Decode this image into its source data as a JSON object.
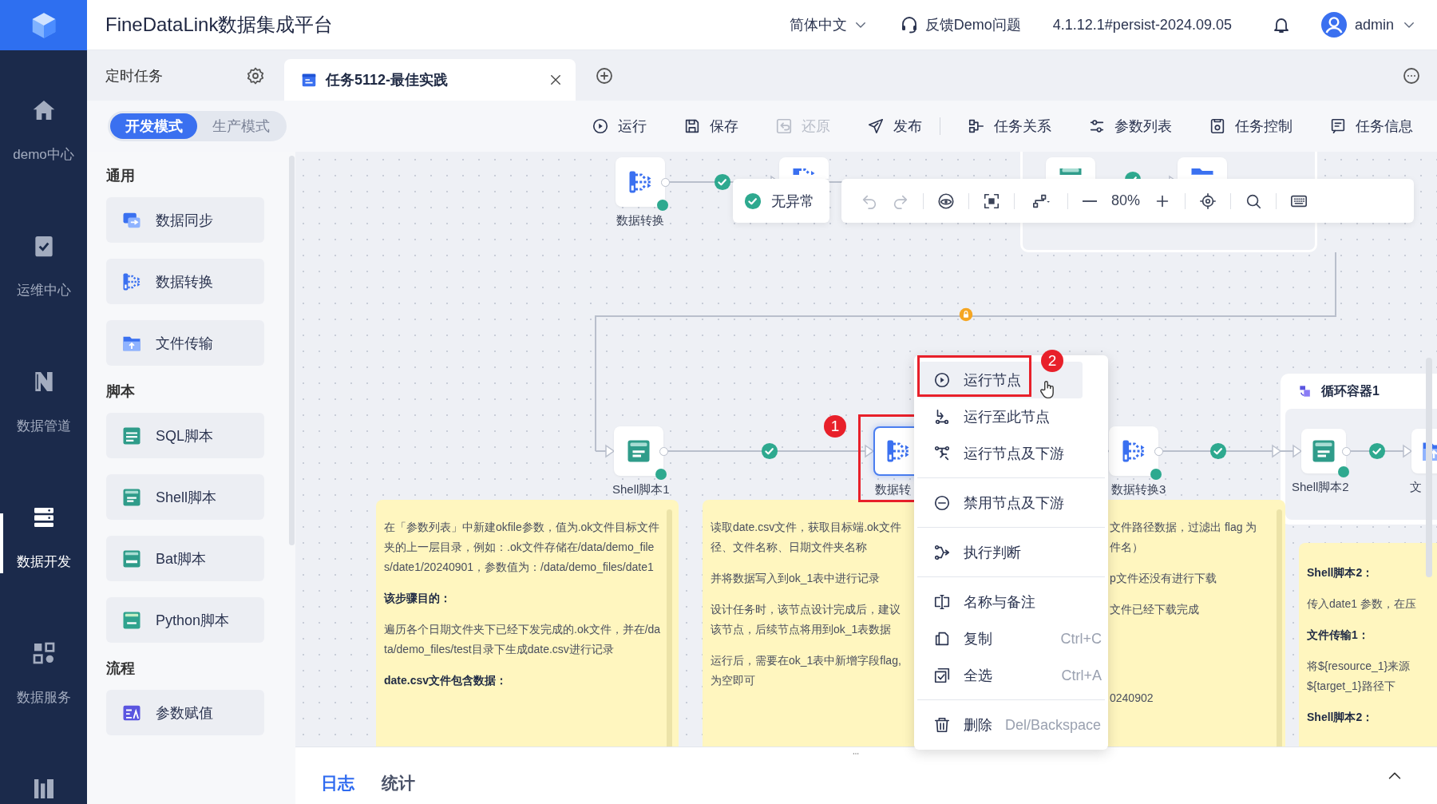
{
  "app": {
    "title": "FineDataLink数据集成平台",
    "language": "简体中文",
    "feedback": "反馈Demo问题",
    "version": "4.1.12.1#persist-2024.09.05",
    "user": "admin"
  },
  "nav": [
    {
      "label": "demo中心",
      "selected": false
    },
    {
      "label": "运维中心",
      "selected": false
    },
    {
      "label": "数据管道",
      "selected": false
    },
    {
      "label": "数据开发",
      "selected": true
    },
    {
      "label": "数据服务",
      "selected": false
    },
    {
      "selected": false
    }
  ],
  "tabs": {
    "section": "定时任务",
    "items": [
      {
        "label": "任务5112-最佳实践",
        "selected": true
      }
    ]
  },
  "modes": [
    {
      "label": "开发模式",
      "selected": true
    },
    {
      "label": "生产模式",
      "selected": false
    }
  ],
  "toolbar": [
    {
      "label": "运行",
      "disabled": false
    },
    {
      "label": "保存",
      "disabled": false
    },
    {
      "label": "还原",
      "disabled": true
    },
    {
      "label": "发布",
      "disabled": false
    },
    {
      "label": "任务关系",
      "disabled": false
    },
    {
      "label": "参数列表",
      "disabled": false
    },
    {
      "label": "任务控制",
      "disabled": false
    },
    {
      "label": "任务信息",
      "disabled": false
    }
  ],
  "palette": [
    {
      "title": "通用",
      "items": [
        {
          "label": "数据同步"
        },
        {
          "label": "数据转换"
        },
        {
          "label": "文件传输"
        }
      ]
    },
    {
      "title": "脚本",
      "items": [
        {
          "label": "SQL脚本"
        },
        {
          "label": "Shell脚本"
        },
        {
          "label": "Bat脚本"
        },
        {
          "label": "Python脚本"
        }
      ]
    },
    {
      "title": "流程",
      "items": [
        {
          "label": "参数赋值"
        }
      ]
    }
  ],
  "canvas": {
    "status": "无异常",
    "zoom": "80%",
    "nodes": [
      {
        "kind": "transform",
        "label": "数据转换",
        "selected": false,
        "succeeded": true
      },
      {
        "kind": "transform",
        "selected": false
      },
      {
        "kind": "shell",
        "selected": false
      },
      {
        "kind": "file",
        "selected": false
      },
      {
        "kind": "shell",
        "label": "Shell脚本1",
        "selected": false,
        "succeeded": true
      },
      {
        "kind": "transform",
        "label": "数据转",
        "selected": true
      },
      {
        "kind": "transform",
        "label": "数据转换3",
        "selected": false,
        "succeeded": true
      },
      {
        "kind": "shell",
        "label": "Shell脚本2",
        "selected": false,
        "succeeded": true
      },
      {
        "kind": "file",
        "label": "文",
        "selected": false
      }
    ],
    "edges": [
      {
        "passed": true
      },
      {
        "passed": true
      },
      {
        "passed": true
      },
      {
        "passed": true
      },
      {
        "passed": true
      }
    ],
    "container": {
      "title": "循环容器1"
    },
    "notes": [
      {
        "paragraphs": [
          {
            "text": "在「参数列表」中新建okfile参数，值为.ok文件目标文件夹的上一层目录，例如：.ok文件存储在/data/demo_files/date1/20240901，参数值为：/data/demo_files/date1",
            "bold": false
          },
          {
            "text": "该步骤目的：",
            "bold": true
          },
          {
            "text": "遍历各个日期文件夹下已经下发完成的.ok文件，并在/data/demo_files/test目录下生成date.csv进行记录",
            "bold": false
          },
          {
            "text": "date.csv文件包含数据：",
            "bold": true
          }
        ]
      },
      {
        "paragraphs": [
          {
            "lines": [
              "读取date.csv文件，获取目标端.ok文件",
              "径、文件名称、日期文件夹名称"
            ],
            "bold": false
          },
          {
            "lines": [
              "并将数据写入到ok_1表中进行记录"
            ],
            "bold": false
          },
          {
            "lines": [
              "设计任务时，该节点设计完成后，建议",
              "该节点，后续节点将用到ok_1表数据"
            ],
            "bold": false
          },
          {
            "lines": [
              "运行后，需要在ok_1表中新增字段flag,",
              "为空即可"
            ],
            "bold": false
          }
        ]
      },
      {
        "paragraphs": [
          {
            "lines": [
              "文件路径数据，过滤出 flag 为",
              "件名）"
            ],
            "bold": false
          },
          {
            "lines": [
              "p文件还没有进行下载"
            ],
            "bold": false
          },
          {
            "lines": [
              "文件已经下载完成"
            ],
            "bold": false
          },
          {
            "lines": [
              "0240902"
            ],
            "bold": false
          }
        ]
      },
      {
        "paragraphs": [
          {
            "lines": [
              "Shell脚本2："
            ],
            "bold": true
          },
          {
            "lines": [
              "传入date1  参数，在压"
            ],
            "bold": false
          },
          {
            "lines": [
              "文件传输1："
            ],
            "bold": true
          },
          {
            "lines": [
              "将${resource_1}来源",
              "${target_1}路径下"
            ],
            "bold": false
          },
          {
            "lines": [
              "Shell脚本2："
            ],
            "bold": true
          }
        ]
      }
    ]
  },
  "context_menu": {
    "groups": [
      [
        {
          "label": "运行节点",
          "hovered": true
        },
        {
          "label": "运行至此节点",
          "hovered": false
        },
        {
          "label": "运行节点及下游",
          "hovered": false
        }
      ],
      [
        {
          "label": "禁用节点及下游",
          "hovered": false
        }
      ],
      [
        {
          "label": "执行判断",
          "hovered": false
        }
      ],
      [
        {
          "label": "名称与备注",
          "hovered": false
        },
        {
          "label": "复制",
          "shortcut": "Ctrl+C",
          "hovered": false
        },
        {
          "label": "全选",
          "shortcut": "Ctrl+A",
          "hovered": false
        }
      ],
      [
        {
          "label": "删除",
          "shortcut": "Del/Backspace",
          "hovered": false
        }
      ]
    ]
  },
  "callouts": [
    {
      "label": "1"
    },
    {
      "label": "2"
    }
  ],
  "bottom": {
    "tabs": [
      {
        "label": "日志",
        "selected": true
      },
      {
        "label": "统计",
        "selected": false
      }
    ]
  }
}
